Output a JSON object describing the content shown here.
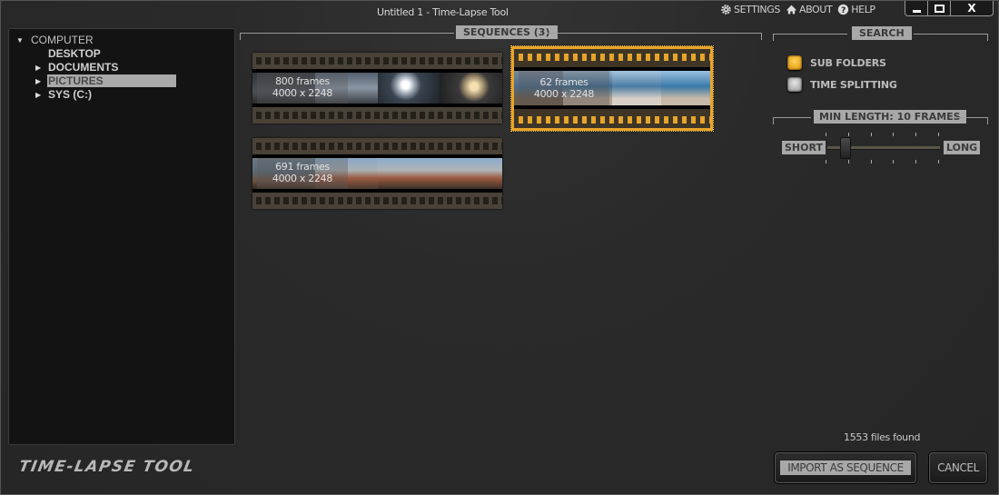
{
  "window": {
    "title": "Untitled 1 - Time-Lapse Tool",
    "menu": [
      {
        "icon": "gear-icon",
        "label": "SETTINGS"
      },
      {
        "icon": "home-icon",
        "label": "ABOUT"
      },
      {
        "icon": "help-icon",
        "label": "HELP"
      }
    ],
    "controls": {
      "minimize": "minimize",
      "maximize": "maximize",
      "close": "X"
    }
  },
  "tree": {
    "root": {
      "label": "COMPUTER",
      "expanded": true
    },
    "children": [
      {
        "label": "DESKTOP",
        "has_children": false,
        "selected": false
      },
      {
        "label": "DOCUMENTS",
        "has_children": true,
        "selected": false
      },
      {
        "label": "PICTURES",
        "has_children": true,
        "selected": true
      },
      {
        "label": "SYS (C:)",
        "has_children": true,
        "selected": false
      }
    ]
  },
  "brand": "TIME-LAPSE TOOL",
  "sequences": {
    "label": "SEQUENCES  (3)",
    "items": [
      {
        "frames": "800 frames",
        "resolution": "4000 x 2248",
        "selected": false,
        "colors": [
          "#3a3f45",
          "#6b7480",
          "#4a5460",
          "#5d5548"
        ]
      },
      {
        "frames": "62 frames",
        "resolution": "4000 x 2248",
        "selected": true,
        "colors": [
          "#5a6470",
          "#4a6f8e",
          "#6b90b0",
          "#55789a"
        ]
      },
      {
        "frames": "691 frames",
        "resolution": "4000 x 2248",
        "selected": false,
        "colors": [
          "#5d6770",
          "#7a8f9e",
          "#8a8070",
          "#7a6a5a"
        ]
      }
    ]
  },
  "search": {
    "label": "SEARCH",
    "options": [
      {
        "label": "SUB FOLDERS",
        "checked": true
      },
      {
        "label": "TIME SPLITTING",
        "checked": false
      }
    ]
  },
  "min_length": {
    "label": "MIN LENGTH: 10 FRAMES",
    "short_label": "SHORT",
    "long_label": "LONG",
    "value_fraction": 0.17
  },
  "status": "1553 files found",
  "buttons": {
    "import": "IMPORT AS SEQUENCE",
    "cancel": "CANCEL"
  },
  "colors": {
    "accent": "#e6a52a",
    "background": "#2a2a2a",
    "panel": "#131313"
  }
}
